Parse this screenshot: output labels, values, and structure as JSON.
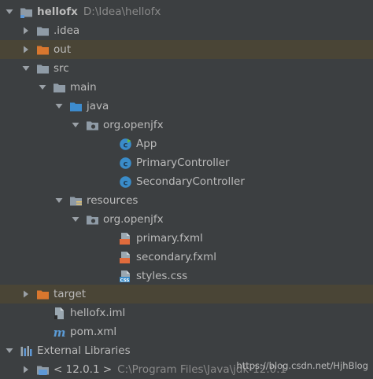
{
  "colors": {
    "background": "#3c3f41",
    "excluded_row": "#4a4536",
    "folder_grey": "#8f9ba6",
    "folder_blue": "#3d8ccf",
    "folder_orange": "#d9772e",
    "class_blue": "#3a8cc9",
    "fxml_orange": "#e06b3c"
  },
  "tree": [
    {
      "label": "hellofx",
      "path": "D:\\Idea\\hellofx",
      "icon": "module-folder-icon",
      "arrow": "expanded",
      "bold": true
    },
    {
      "label": ".idea",
      "icon": "folder-icon",
      "arrow": "collapsed"
    },
    {
      "label": "out",
      "icon": "excluded-folder-icon",
      "arrow": "collapsed",
      "excluded": true
    },
    {
      "label": "src",
      "icon": "folder-icon",
      "arrow": "expanded"
    },
    {
      "label": "main",
      "icon": "folder-icon",
      "arrow": "expanded"
    },
    {
      "label": "java",
      "icon": "source-root-folder-icon",
      "arrow": "expanded"
    },
    {
      "label": "org.openjfx",
      "icon": "package-icon",
      "arrow": "expanded"
    },
    {
      "label": "App",
      "icon": "application-class-icon"
    },
    {
      "label": "PrimaryController",
      "icon": "class-icon"
    },
    {
      "label": "SecondaryController",
      "icon": "class-icon"
    },
    {
      "label": "resources",
      "icon": "resources-root-folder-icon",
      "arrow": "expanded"
    },
    {
      "label": "org.openjfx",
      "icon": "package-icon",
      "arrow": "expanded"
    },
    {
      "label": "primary.fxml",
      "icon": "fxml-file-icon"
    },
    {
      "label": "secondary.fxml",
      "icon": "fxml-file-icon"
    },
    {
      "label": "styles.css",
      "icon": "css-file-icon"
    },
    {
      "label": "target",
      "icon": "excluded-folder-icon",
      "arrow": "collapsed",
      "excluded": true
    },
    {
      "label": "hellofx.iml",
      "icon": "iml-file-icon"
    },
    {
      "label": "pom.xml",
      "icon": "maven-file-icon"
    },
    {
      "label": "External Libraries",
      "icon": "libraries-icon",
      "arrow": "expanded"
    },
    {
      "label": "< 12.0.1 >",
      "path": "C:\\Program Files\\Java\\jdk-12.0.1",
      "icon": "jdk-icon",
      "arrow": "collapsed"
    }
  ],
  "watermark": "https://blog.csdn.net/HjhBlog"
}
